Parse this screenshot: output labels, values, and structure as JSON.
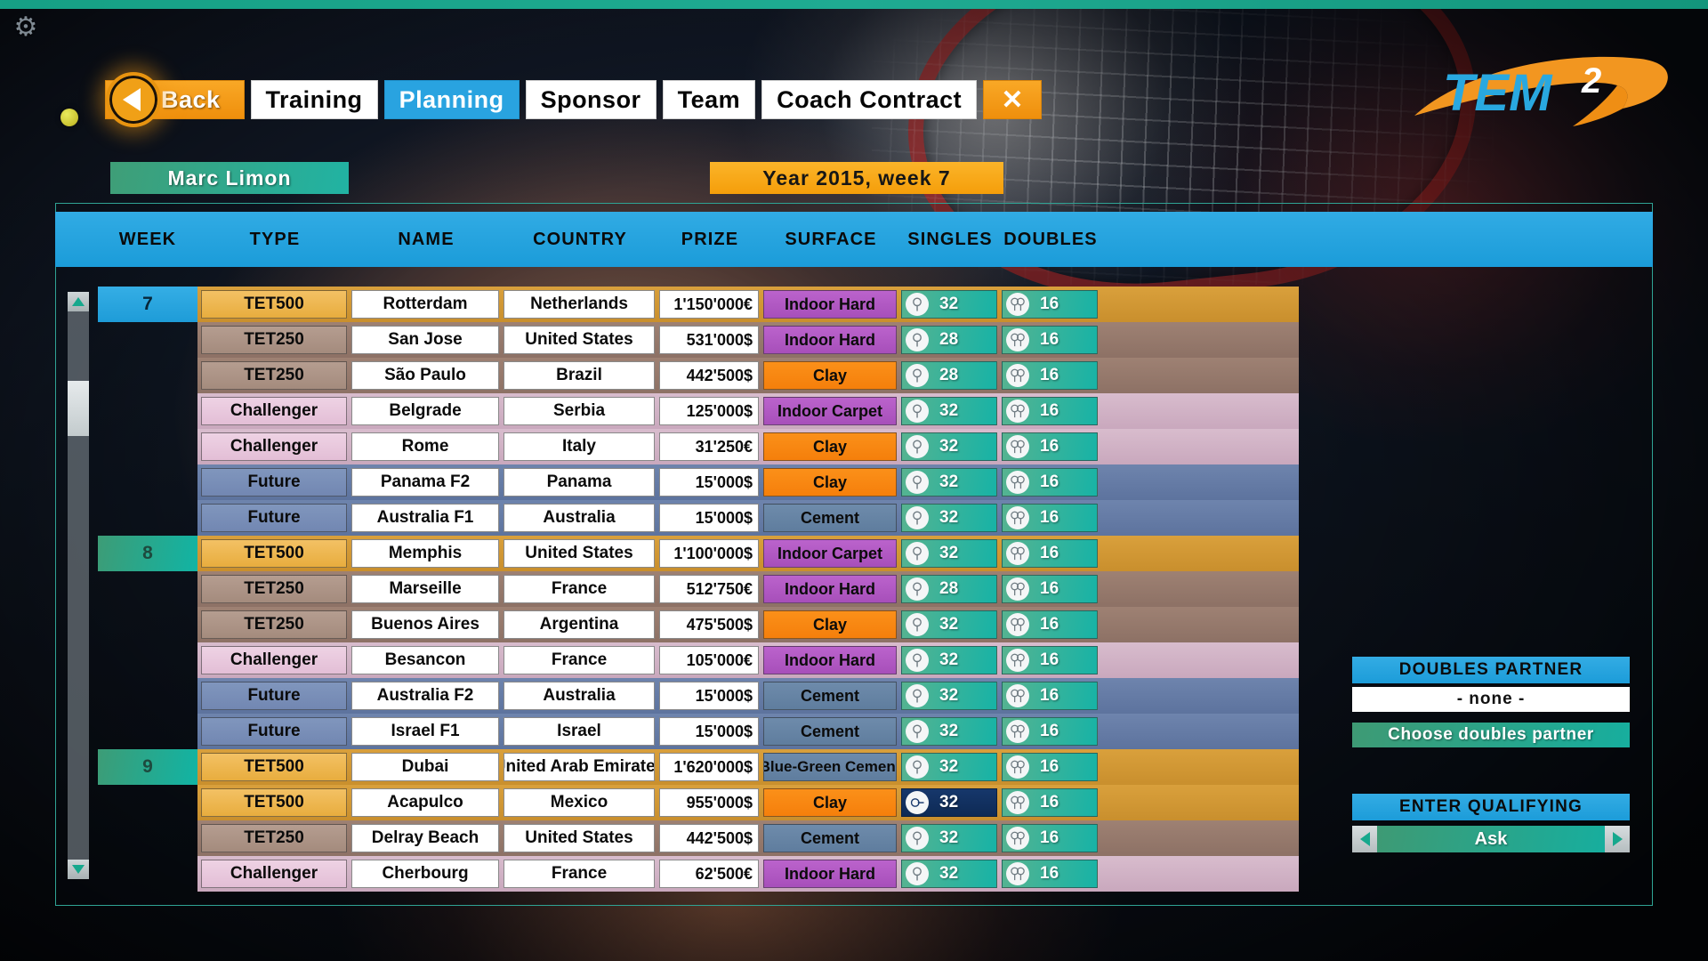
{
  "app": {
    "logo_text": "TEM",
    "logo_superscript": "2",
    "gear_icon": "gear-icon"
  },
  "nav": {
    "back_label": "Back",
    "back_arrow_icon": "left-triangle-icon",
    "items": [
      {
        "label": "Training",
        "active": false
      },
      {
        "label": "Planning",
        "active": true
      },
      {
        "label": "Sponsor",
        "active": false
      },
      {
        "label": "Team",
        "active": false
      },
      {
        "label": "Coach Contract",
        "active": false
      }
    ],
    "close_label": "✕"
  },
  "banners": {
    "player_name": "Marc Limon",
    "date": "Year 2015, week 7"
  },
  "table": {
    "headers": [
      "WEEK",
      "TYPE",
      "NAME",
      "COUNTRY",
      "PRIZE",
      "SURFACE",
      "SINGLES",
      "DOUBLES"
    ],
    "rows": [
      {
        "week": "7",
        "week_style": "blue",
        "type": "TET500",
        "type_key": "t500",
        "name": "Rotterdam",
        "country": "Netherlands",
        "prize": "1'150'000€",
        "surface": "Indoor Hard",
        "surface_key": "indoorhard",
        "singles": "32",
        "doubles": "16",
        "singles_selected": false
      },
      {
        "week": "",
        "week_style": "empty",
        "type": "TET250",
        "type_key": "t250",
        "name": "San Jose",
        "country": "United States",
        "prize": "531'000$",
        "surface": "Indoor Hard",
        "surface_key": "indoorhard",
        "singles": "28",
        "doubles": "16",
        "singles_selected": false
      },
      {
        "week": "",
        "week_style": "empty",
        "type": "TET250",
        "type_key": "t250",
        "name": "São Paulo",
        "country": "Brazil",
        "prize": "442'500$",
        "surface": "Clay",
        "surface_key": "clay",
        "singles": "28",
        "doubles": "16",
        "singles_selected": false
      },
      {
        "week": "",
        "week_style": "empty",
        "type": "Challenger",
        "type_key": "tchal",
        "name": "Belgrade",
        "country": "Serbia",
        "prize": "125'000$",
        "surface": "Indoor Carpet",
        "surface_key": "indoorcarpet",
        "singles": "32",
        "doubles": "16",
        "singles_selected": false
      },
      {
        "week": "",
        "week_style": "empty",
        "type": "Challenger",
        "type_key": "tchal",
        "name": "Rome",
        "country": "Italy",
        "prize": "31'250€",
        "surface": "Clay",
        "surface_key": "clay",
        "singles": "32",
        "doubles": "16",
        "singles_selected": false
      },
      {
        "week": "",
        "week_style": "empty",
        "type": "Future",
        "type_key": "tfut",
        "name": "Panama F2",
        "country": "Panama",
        "prize": "15'000$",
        "surface": "Clay",
        "surface_key": "clay",
        "singles": "32",
        "doubles": "16",
        "singles_selected": false
      },
      {
        "week": "",
        "week_style": "empty",
        "type": "Future",
        "type_key": "tfut",
        "name": "Australia F1",
        "country": "Australia",
        "prize": "15'000$",
        "surface": "Cement",
        "surface_key": "cement",
        "singles": "32",
        "doubles": "16",
        "singles_selected": false
      },
      {
        "week": "8",
        "week_style": "green",
        "type": "TET500",
        "type_key": "t500",
        "name": "Memphis",
        "country": "United States",
        "prize": "1'100'000$",
        "surface": "Indoor Carpet",
        "surface_key": "indoorcarpet",
        "singles": "32",
        "doubles": "16",
        "singles_selected": false
      },
      {
        "week": "",
        "week_style": "empty",
        "type": "TET250",
        "type_key": "t250",
        "name": "Marseille",
        "country": "France",
        "prize": "512'750€",
        "surface": "Indoor Hard",
        "surface_key": "indoorhard",
        "singles": "28",
        "doubles": "16",
        "singles_selected": false
      },
      {
        "week": "",
        "week_style": "empty",
        "type": "TET250",
        "type_key": "t250",
        "name": "Buenos Aires",
        "country": "Argentina",
        "prize": "475'500$",
        "surface": "Clay",
        "surface_key": "clay",
        "singles": "32",
        "doubles": "16",
        "singles_selected": false
      },
      {
        "week": "",
        "week_style": "empty",
        "type": "Challenger",
        "type_key": "tchal",
        "name": "Besancon",
        "country": "France",
        "prize": "105'000€",
        "surface": "Indoor Hard",
        "surface_key": "indoorhard",
        "singles": "32",
        "doubles": "16",
        "singles_selected": false
      },
      {
        "week": "",
        "week_style": "empty",
        "type": "Future",
        "type_key": "tfut",
        "name": "Australia F2",
        "country": "Australia",
        "prize": "15'000$",
        "surface": "Cement",
        "surface_key": "cement",
        "singles": "32",
        "doubles": "16",
        "singles_selected": false
      },
      {
        "week": "",
        "week_style": "empty",
        "type": "Future",
        "type_key": "tfut",
        "name": "Israel F1",
        "country": "Israel",
        "prize": "15'000$",
        "surface": "Cement",
        "surface_key": "cement",
        "singles": "32",
        "doubles": "16",
        "singles_selected": false
      },
      {
        "week": "9",
        "week_style": "green",
        "type": "TET500",
        "type_key": "t500",
        "name": "Dubai",
        "country": "United Arab Emirates",
        "prize": "1'620'000$",
        "surface": "Blue-Green Cement",
        "surface_key": "bluegreen",
        "singles": "32",
        "doubles": "16",
        "singles_selected": false
      },
      {
        "week": "",
        "week_style": "empty",
        "type": "TET500",
        "type_key": "t500",
        "name": "Acapulco",
        "country": "Mexico",
        "prize": "955'000$",
        "surface": "Clay",
        "surface_key": "clay",
        "singles": "32",
        "doubles": "16",
        "singles_selected": true
      },
      {
        "week": "",
        "week_style": "empty",
        "type": "TET250",
        "type_key": "t250",
        "name": "Delray Beach",
        "country": "United States",
        "prize": "442'500$",
        "surface": "Cement",
        "surface_key": "cement",
        "singles": "32",
        "doubles": "16",
        "singles_selected": false
      },
      {
        "week": "",
        "week_style": "empty",
        "type": "Challenger",
        "type_key": "tchal",
        "name": "Cherbourg",
        "country": "France",
        "prize": "62'500€",
        "surface": "Indoor Hard",
        "surface_key": "indoorhard",
        "singles": "32",
        "doubles": "16",
        "singles_selected": false
      }
    ]
  },
  "sidepanel": {
    "doubles_partner_title": "DOUBLES PARTNER",
    "doubles_partner_value": "- none -",
    "choose_partner_label": "Choose doubles partner",
    "enter_qualifying_title": "ENTER QUALIFYING",
    "qualifying_value": "Ask",
    "stepper_prev_icon": "left-triangle-icon",
    "stepper_next_icon": "right-triangle-icon"
  },
  "scrollbar": {
    "up_icon": "up-triangle-icon",
    "down_icon": "down-triangle-icon"
  },
  "colors": {
    "accent_blue": "#1e9cd8",
    "accent_orange": "#f59e0a",
    "accent_green": "#17ae9e",
    "surface_clay": "#f57f0b",
    "surface_indoor_hard": "#a74fba",
    "surface_cement": "#5f7d9e",
    "selected_row": "#0e2a55"
  }
}
